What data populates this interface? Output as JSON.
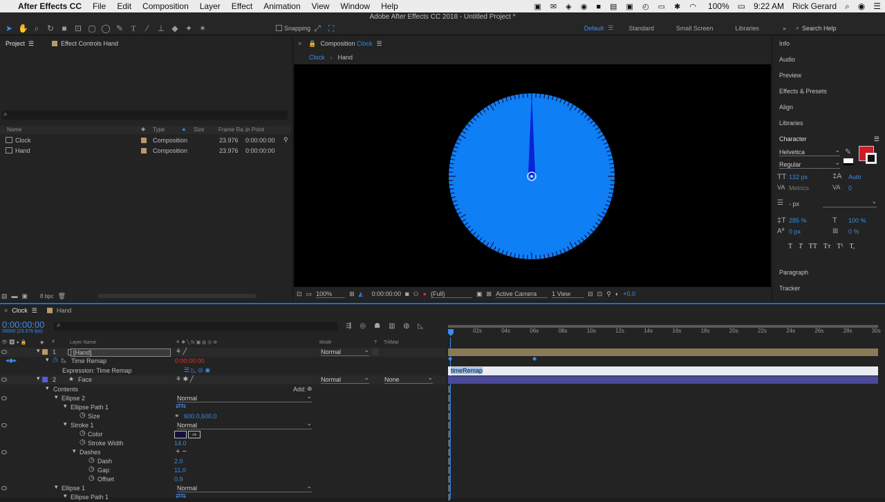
{
  "menubar": {
    "apple": "",
    "app": "After Effects CC",
    "items": [
      "File",
      "Edit",
      "Composition",
      "Layer",
      "Effect",
      "Animation",
      "View",
      "Window",
      "Help"
    ],
    "battery": "100%",
    "time": "9:22 AM",
    "user": "Rick Gerard"
  },
  "titlebar": {
    "title": "Adobe After Effects CC 2018 - Untitled Project *"
  },
  "toolbar": {
    "snapping": "Snapping",
    "workspaces": [
      "Default",
      "Standard",
      "Small Screen",
      "Libraries"
    ],
    "search": "Search Help"
  },
  "project": {
    "tabs": [
      "Project",
      "Effect Controls Hand"
    ],
    "columns": [
      "Name",
      "Type",
      "Size",
      "Frame Ra...",
      "In Point"
    ],
    "rows": [
      {
        "name": "Clock",
        "type": "Composition",
        "fps": "23.976",
        "in": "0:00:00:00"
      },
      {
        "name": "Hand",
        "type": "Composition",
        "fps": "23.976",
        "in": "0:00:00:00"
      }
    ],
    "bpc": "8 bpc"
  },
  "comp": {
    "panel": "Composition",
    "panel_name": "Clock",
    "breadcrumbs": [
      "Clock",
      "Hand"
    ],
    "zoom": "100%",
    "timecode": "0:00:00:00",
    "res": "(Full)",
    "camera": "Active Camera",
    "views": "1 View",
    "exposure": "+0.0",
    "face_color": "#0f7ff5",
    "hand_color": "#0a22d8"
  },
  "right": {
    "panels": [
      "Info",
      "Audio",
      "Preview",
      "Effects & Presets",
      "Align",
      "Libraries"
    ],
    "character": {
      "title": "Character",
      "font": "Helvetica",
      "style": "Regular",
      "size": "132 px",
      "leading": "Auto",
      "kerning": "Metrics",
      "tracking": "0",
      "stroke": "- px",
      "vscale": "285 %",
      "hscale": "100 %",
      "baseline": "0 px",
      "tsume": "0 %",
      "styles": [
        "T",
        "T",
        "TT",
        "Tт",
        "T¹",
        "T,"
      ],
      "fill": "#cf1b24"
    },
    "bottom": [
      "Paragraph",
      "Tracker"
    ]
  },
  "timeline": {
    "tabs": [
      "Clock",
      "Hand"
    ],
    "timecode": "0:00:00:00",
    "fps": "00000 (23.976 fps)",
    "header": {
      "layer_name": "Layer Name",
      "mode": "Mode",
      "t": "T",
      "trkmat": "TrkMat"
    },
    "ruler": [
      "02s",
      "04s",
      "06s",
      "08s",
      "10s",
      "12s",
      "14s",
      "16s",
      "18s",
      "20s",
      "22s",
      "24s",
      "26s",
      "28s",
      "30s"
    ],
    "rows": [
      {
        "n": "1",
        "label": "[Hand]",
        "mode": "Normal"
      },
      {
        "label": "Time Remap",
        "value": "0:00:00:00"
      },
      {
        "label": "Expression: Time Remap"
      },
      {
        "n": "2",
        "label": "Face",
        "mode": "Normal",
        "trk": "None"
      },
      {
        "label": "Contents",
        "add": "Add:"
      },
      {
        "label": "Ellipse 2",
        "mode": "Normal"
      },
      {
        "label": "Ellipse Path 1"
      },
      {
        "label": "Size",
        "value": "600.0,600.0"
      },
      {
        "label": "Stroke 1",
        "mode": "Normal"
      },
      {
        "label": "Color"
      },
      {
        "label": "Stroke Width",
        "value": "14.0"
      },
      {
        "label": "Dashes"
      },
      {
        "label": "Dash",
        "value": "2.0"
      },
      {
        "label": "Gap",
        "value": "11.0"
      },
      {
        "label": "Offset",
        "value": "0.9"
      },
      {
        "label": "Ellipse 1",
        "mode": "Normal"
      },
      {
        "label": "Ellipse Path 1"
      }
    ],
    "expression": "timeRemap",
    "stroke_color": "#14103a"
  }
}
